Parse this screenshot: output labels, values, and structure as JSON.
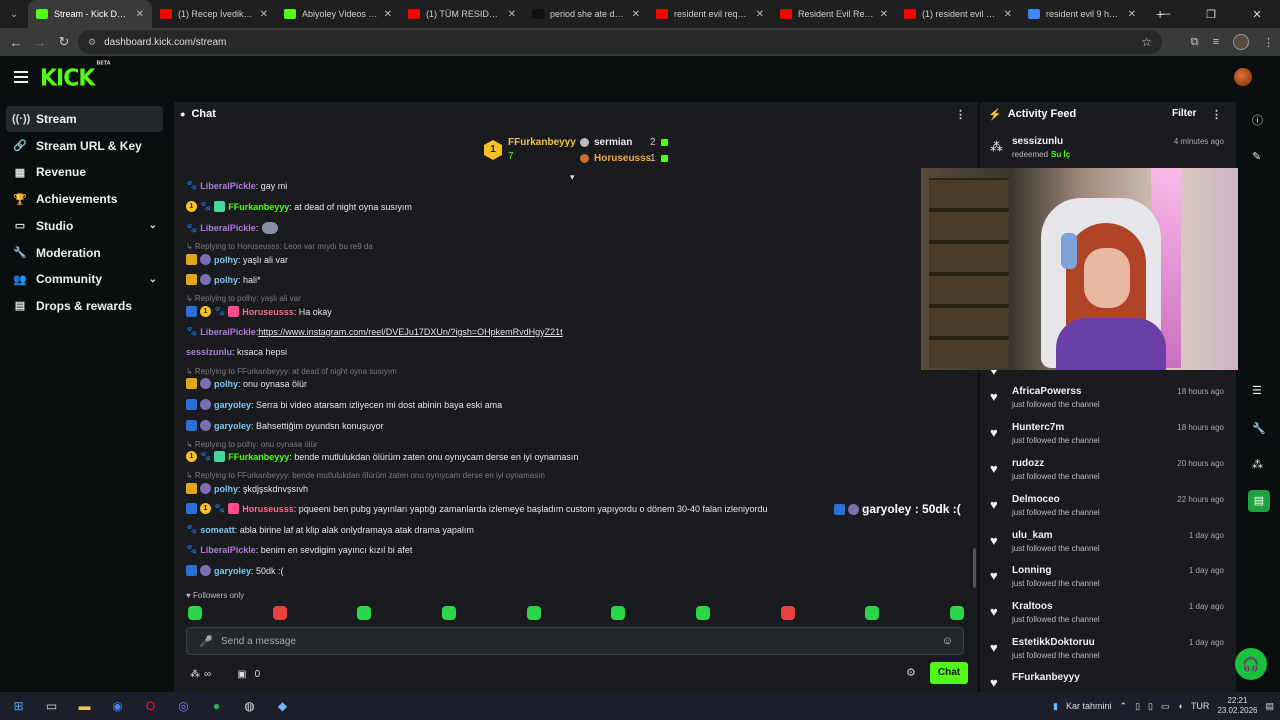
{
  "browser": {
    "tabs": [
      {
        "title": "Stream - Kick Dashboard",
        "color": "#53fc18",
        "active": true
      },
      {
        "title": "(1) Recep İvedik'in Pa",
        "color": "#ff0000",
        "active": false
      },
      {
        "title": "Abiyoley Videos - Wa",
        "color": "#53fc18",
        "active": false
      },
      {
        "title": "(1) TÜM RESIDENT EV",
        "color": "#ff0000",
        "active": false
      },
      {
        "title": "period she ate down",
        "color": "#111111",
        "active": false
      },
      {
        "title": "resident evil requiem",
        "color": "#ff0000",
        "active": false
      },
      {
        "title": "Resident Evil Requiem",
        "color": "#ff0000",
        "active": false
      },
      {
        "title": "(1) resident evil 9 - Y",
        "color": "#ff0000",
        "active": false
      },
      {
        "title": "resident evil 9 how m",
        "color": "#4285f4",
        "active": false
      }
    ],
    "url": "dashboard.kick.com/stream"
  },
  "header": {
    "logo": "KICK",
    "logo_sup": "BETA"
  },
  "sidebar": {
    "items": [
      {
        "label": "Stream",
        "icon": "((·))",
        "active": true
      },
      {
        "label": "Stream URL & Key",
        "icon": "🔗",
        "active": false
      },
      {
        "label": "Revenue",
        "icon": "▦",
        "active": false
      },
      {
        "label": "Achievements",
        "icon": "🏆",
        "active": false
      },
      {
        "label": "Studio",
        "icon": "▭",
        "active": false,
        "chevron": true
      },
      {
        "label": "Moderation",
        "icon": "🔧",
        "active": false
      },
      {
        "label": "Community",
        "icon": "👥",
        "active": false,
        "chevron": true
      },
      {
        "label": "Drops & rewards",
        "icon": "▤",
        "active": false
      }
    ]
  },
  "chat": {
    "title": "Chat",
    "leaderboard": {
      "top_name": "FFurkanbeyyy",
      "top_count": "7",
      "top_rank": "1",
      "rows": [
        {
          "name": "sermian",
          "count": "2",
          "color": "#ffffff"
        },
        {
          "name": "Horuseusss",
          "count": "1",
          "color": "#f3a73d"
        }
      ]
    },
    "messages": [
      {
        "type": "msg",
        "badges": [
          "paw"
        ],
        "user": "LiberalPickle",
        "ucolor": "#b07ad8",
        "text": ": gay mi"
      },
      {
        "type": "msg",
        "badges": [
          "one",
          "paw",
          "gift"
        ],
        "user": "FFurkanbeyyy",
        "ucolor": "#53fc18",
        "text": ": at dead of night oyna susıyım"
      },
      {
        "type": "msg",
        "badges": [
          "paw"
        ],
        "user": "LiberalPickle",
        "ucolor": "#b07ad8",
        "text": ":",
        "emote": true
      },
      {
        "type": "reply",
        "text": "↳ Replying to Horuseusss: Leon var mıydı bu re9 da"
      },
      {
        "type": "msg",
        "badges": [
          "crown",
          "badge2"
        ],
        "user": "polhy",
        "ucolor": "#7ec8f0",
        "text": ": yaşlı ali var"
      },
      {
        "type": "msg",
        "badges": [
          "crown",
          "badge2"
        ],
        "user": "polhy",
        "ucolor": "#7ec8f0",
        "text": ": hali*"
      },
      {
        "type": "reply",
        "text": "↳ Replying to polhy: yaşlı ali var"
      },
      {
        "type": "msg",
        "badges": [
          "blue",
          "one",
          "paw",
          "sub"
        ],
        "user": "Horuseusss",
        "ucolor": "#ff6a8a",
        "text": ": Ha okay"
      },
      {
        "type": "msg",
        "badges": [
          "paw"
        ],
        "user": "LiberalPickle",
        "ucolor": "#b07ad8",
        "text": ": ",
        "link": "https://www.instagram.com/reel/DVEJu17DXUn/?igsh=OHpkemRvdHgyZ21t"
      },
      {
        "type": "msg",
        "badges": [],
        "user": "sessizunlu",
        "ucolor": "#b07ad8",
        "text": ": kısaca hepsi"
      },
      {
        "type": "reply",
        "text": "↳ Replying to FFurkanbeyyy: at dead of night oyna susıyım"
      },
      {
        "type": "msg",
        "badges": [
          "crown",
          "badge2"
        ],
        "user": "polhy",
        "ucolor": "#7ec8f0",
        "text": ": onu oynasa ölür"
      },
      {
        "type": "msg",
        "badges": [
          "blue",
          "badge2"
        ],
        "user": "garyoley",
        "ucolor": "#7ec8f0",
        "text": ": Serra bi video atarsam izliyecen mi dost abinin baya eski ama"
      },
      {
        "type": "msg",
        "badges": [
          "blue",
          "badge2"
        ],
        "user": "garyoley",
        "ucolor": "#7ec8f0",
        "text": ": Bahsettiğim oyundsn konuşuyor"
      },
      {
        "type": "reply",
        "text": "↳ Replying to polhy: onu oynasa ölür"
      },
      {
        "type": "msg",
        "badges": [
          "one",
          "paw",
          "gift"
        ],
        "user": "FFurkanbeyyy",
        "ucolor": "#53fc18",
        "text": ": bende mutlulukdan ölürüm zaten onu oynıycam derse en iyi oynamasın"
      },
      {
        "type": "reply",
        "text": "↳ Replying to FFurkanbeyyy: bende mutlulukdan ölürüm zaten onu oynıycam derse en iyi oynamasın"
      },
      {
        "type": "msg",
        "badges": [
          "crown",
          "badge2"
        ],
        "user": "polhy",
        "ucolor": "#7ec8f0",
        "text": ": şkdjşskdnvşsıvh"
      },
      {
        "type": "msg",
        "badges": [
          "blue",
          "one",
          "paw",
          "sub"
        ],
        "user": "Horuseusss",
        "ucolor": "#ff6a8a",
        "text": ": pqueeni ben pubg yayınları yaptığı zamanlarda izlemeye başladım custom yapıyordu o dönem 30-40 falan izleniyordu"
      },
      {
        "type": "msg",
        "badges": [
          "paw"
        ],
        "user": "someatt",
        "ucolor": "#7ec8f0",
        "text": ": abla birine laf at klip alak onlydramaya atak drama yapalım"
      },
      {
        "type": "msg",
        "badges": [
          "paw"
        ],
        "user": "LiberalPickle",
        "ucolor": "#b07ad8",
        "text": ": benim en sevdigim yayıncı kızıl bi afet"
      },
      {
        "type": "msg",
        "badges": [
          "blue",
          "badge2"
        ],
        "user": "garyoley",
        "ucolor": "#7ec8f0",
        "text": ": 50dk :("
      }
    ],
    "floating": "garyoley : 50dk :(",
    "followers_only": "Followers only",
    "input_placeholder": "Send a message",
    "viewers_label": "∞",
    "points": "0",
    "send_label": "Chat"
  },
  "feed": {
    "title": "Activity Feed",
    "filter": "Filter",
    "items": [
      {
        "name": "sessizunlu",
        "sub": "redeemed",
        "reward": "Su İç",
        "time": "4 minutes ago",
        "icon": "coins"
      },
      {
        "name": "",
        "sub": "just followed the channel",
        "time": "",
        "icon": "heart"
      },
      {
        "name": "AfricaPowerss",
        "sub": "just followed the channel",
        "time": "18 hours ago",
        "icon": "heart"
      },
      {
        "name": "Hunterc7m",
        "sub": "just followed the channel",
        "time": "18 hours ago",
        "icon": "heart"
      },
      {
        "name": "rudozz",
        "sub": "just followed the channel",
        "time": "20 hours ago",
        "icon": "heart"
      },
      {
        "name": "Delmoceo",
        "sub": "just followed the channel",
        "time": "22 hours ago",
        "icon": "heart"
      },
      {
        "name": "ulu_kam",
        "sub": "just followed the channel",
        "time": "1 day ago",
        "icon": "heart"
      },
      {
        "name": "Lonning",
        "sub": "just followed the channel",
        "time": "1 day ago",
        "icon": "heart"
      },
      {
        "name": "Kraltoos",
        "sub": "just followed the channel",
        "time": "1 day ago",
        "icon": "heart"
      },
      {
        "name": "EstetikkDoktoruu",
        "sub": "just followed the channel",
        "time": "1 day ago",
        "icon": "heart"
      },
      {
        "name": "FFurkanbeyyy",
        "sub": "",
        "time": "",
        "icon": "heart"
      }
    ]
  },
  "taskbar": {
    "weather": "Kar tahmini",
    "lang": "TUR",
    "time": "22:21",
    "date": "23.02.2026"
  }
}
